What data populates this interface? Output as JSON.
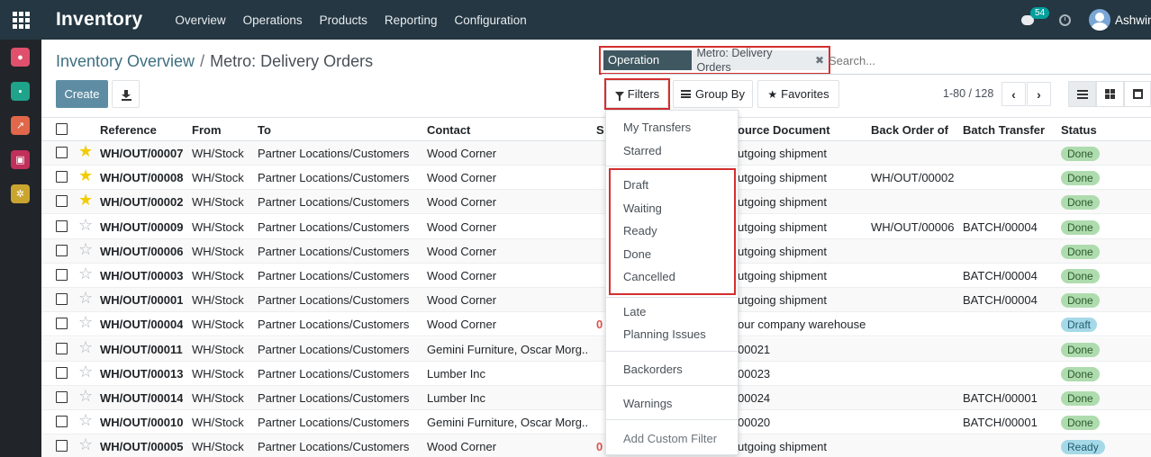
{
  "app": {
    "title": "Inventory",
    "menu": [
      "Overview",
      "Operations",
      "Products",
      "Reporting",
      "Configuration"
    ],
    "chat_count": "54",
    "user_name": "Ashwin"
  },
  "breadcrumb": {
    "parent": "Inventory Overview",
    "separator": "/",
    "current": "Metro: Delivery Orders"
  },
  "search": {
    "facet_label": "Operation Type",
    "facet_value": "Metro: Delivery Orders",
    "facet_remove": "✖",
    "placeholder": "Search..."
  },
  "toolbar": {
    "create_label": "Create",
    "filters_label": "Filters",
    "group_by_label": "Group By",
    "favorites_label": "Favorites",
    "pager": "1-80 / 128",
    "prev": "‹",
    "next": "›"
  },
  "columns": {
    "reference": "Reference",
    "from": "From",
    "to": "To",
    "contact": "Contact",
    "scheduled": "S",
    "source": "ource Document",
    "back_order": "Back Order of",
    "batch": "Batch Transfer",
    "status": "Status"
  },
  "rows": [
    {
      "starred": true,
      "reference": "WH/OUT/00007",
      "from": "WH/Stock",
      "to": "Partner Locations/Customers",
      "contact": "Wood Corner",
      "scheduled": "",
      "source": "utgoing shipment",
      "back_order": "",
      "batch": "",
      "status": "Done"
    },
    {
      "starred": true,
      "reference": "WH/OUT/00008",
      "from": "WH/Stock",
      "to": "Partner Locations/Customers",
      "contact": "Wood Corner",
      "scheduled": "",
      "source": "utgoing shipment",
      "back_order": "WH/OUT/00002",
      "batch": "",
      "status": "Done"
    },
    {
      "starred": true,
      "reference": "WH/OUT/00002",
      "from": "WH/Stock",
      "to": "Partner Locations/Customers",
      "contact": "Wood Corner",
      "scheduled": "",
      "source": "utgoing shipment",
      "back_order": "",
      "batch": "",
      "status": "Done"
    },
    {
      "starred": false,
      "reference": "WH/OUT/00009",
      "from": "WH/Stock",
      "to": "Partner Locations/Customers",
      "contact": "Wood Corner",
      "scheduled": "",
      "source": "utgoing shipment",
      "back_order": "WH/OUT/00006",
      "batch": "BATCH/00004",
      "status": "Done"
    },
    {
      "starred": false,
      "reference": "WH/OUT/00006",
      "from": "WH/Stock",
      "to": "Partner Locations/Customers",
      "contact": "Wood Corner",
      "scheduled": "",
      "source": "utgoing shipment",
      "back_order": "",
      "batch": "",
      "status": "Done"
    },
    {
      "starred": false,
      "reference": "WH/OUT/00003",
      "from": "WH/Stock",
      "to": "Partner Locations/Customers",
      "contact": "Wood Corner",
      "scheduled": "",
      "source": "utgoing shipment",
      "back_order": "",
      "batch": "BATCH/00004",
      "status": "Done"
    },
    {
      "starred": false,
      "reference": "WH/OUT/00001",
      "from": "WH/Stock",
      "to": "Partner Locations/Customers",
      "contact": "Wood Corner",
      "scheduled": "",
      "source": "utgoing shipment",
      "back_order": "",
      "batch": "BATCH/00004",
      "status": "Done"
    },
    {
      "starred": false,
      "reference": "WH/OUT/00004",
      "from": "WH/Stock",
      "to": "Partner Locations/Customers",
      "contact": "Wood Corner",
      "scheduled": "0",
      "source": "our company warehouse",
      "back_order": "",
      "batch": "",
      "status": "Draft"
    },
    {
      "starred": false,
      "reference": "WH/OUT/00011",
      "from": "WH/Stock",
      "to": "Partner Locations/Customers",
      "contact": "Gemini Furniture, Oscar Morg...",
      "scheduled": "",
      "source": "00021",
      "back_order": "",
      "batch": "",
      "status": "Done"
    },
    {
      "starred": false,
      "reference": "WH/OUT/00013",
      "from": "WH/Stock",
      "to": "Partner Locations/Customers",
      "contact": "Lumber Inc",
      "scheduled": "",
      "source": "00023",
      "back_order": "",
      "batch": "",
      "status": "Done"
    },
    {
      "starred": false,
      "reference": "WH/OUT/00014",
      "from": "WH/Stock",
      "to": "Partner Locations/Customers",
      "contact": "Lumber Inc",
      "scheduled": "",
      "source": "00024",
      "back_order": "",
      "batch": "BATCH/00001",
      "status": "Done"
    },
    {
      "starred": false,
      "reference": "WH/OUT/00010",
      "from": "WH/Stock",
      "to": "Partner Locations/Customers",
      "contact": "Gemini Furniture, Oscar Morg...",
      "scheduled": "",
      "source": "00020",
      "back_order": "",
      "batch": "BATCH/00001",
      "status": "Done"
    },
    {
      "starred": false,
      "reference": "WH/OUT/00005",
      "from": "WH/Stock",
      "to": "Partner Locations/Customers",
      "contact": "Wood Corner",
      "scheduled": "0",
      "source": "utgoing shipment",
      "back_order": "",
      "batch": "",
      "status": "Ready"
    }
  ],
  "filters_menu": {
    "group1": [
      "My Transfers",
      "Starred"
    ],
    "group2": [
      "Draft",
      "Waiting",
      "Ready",
      "Done",
      "Cancelled"
    ],
    "group3": [
      "Late",
      "Planning Issues"
    ],
    "group4": [
      "Backorders"
    ],
    "group5": [
      "Warnings"
    ],
    "add_custom": "Add Custom Filter"
  },
  "colors": {
    "navbar": "#243742",
    "sidebar": "#212529",
    "primary": "#5e8da3",
    "highlight": "#d32f2f",
    "status_done": "#aedcae",
    "status_draft": "#a5d9e8",
    "star_on": "#f3cc00"
  },
  "icons": {
    "apps": "grid-icon",
    "chat": "chat-icon",
    "activity": "clock-icon",
    "download": "download-icon",
    "filter": "funnel-icon",
    "group_by": "bars-icon",
    "favorites": "star-icon",
    "list_view": "list-icon",
    "kanban_view": "kanban-icon",
    "calendar_view": "calendar-icon"
  }
}
